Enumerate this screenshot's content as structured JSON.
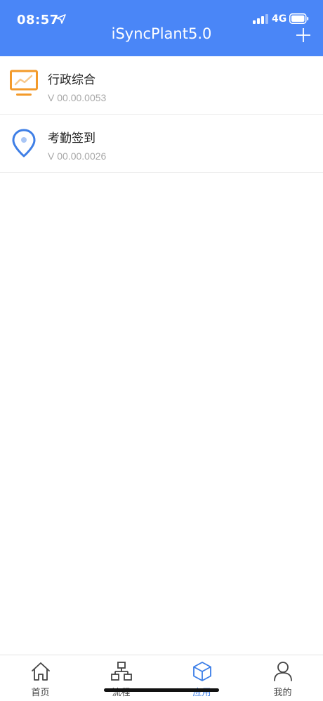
{
  "status_bar": {
    "time": "08:57",
    "network": "4G",
    "icons": [
      "location-arrow-icon",
      "signal-icon",
      "battery-icon"
    ]
  },
  "header": {
    "title": "iSyncPlant5.0",
    "add_icon": "plus-icon"
  },
  "apps": [
    {
      "name": "行政综合",
      "version": "V 00.00.0053",
      "icon": "monitor-chart-icon",
      "icon_color": "#f39a2a"
    },
    {
      "name": "考勤签到",
      "version": "V 00.00.0026",
      "icon": "location-pin-icon",
      "icon_color": "#3f7fe6"
    }
  ],
  "tabbar": {
    "items": [
      {
        "label": "首页",
        "icon": "home-icon",
        "active": false
      },
      {
        "label": "流程",
        "icon": "flowchart-icon",
        "active": false
      },
      {
        "label": "应用",
        "icon": "cube-icon",
        "active": true
      },
      {
        "label": "我的",
        "icon": "user-icon",
        "active": false
      }
    ],
    "active_color": "#3b7ee8"
  },
  "colors": {
    "header_bg": "#4a86f7"
  }
}
